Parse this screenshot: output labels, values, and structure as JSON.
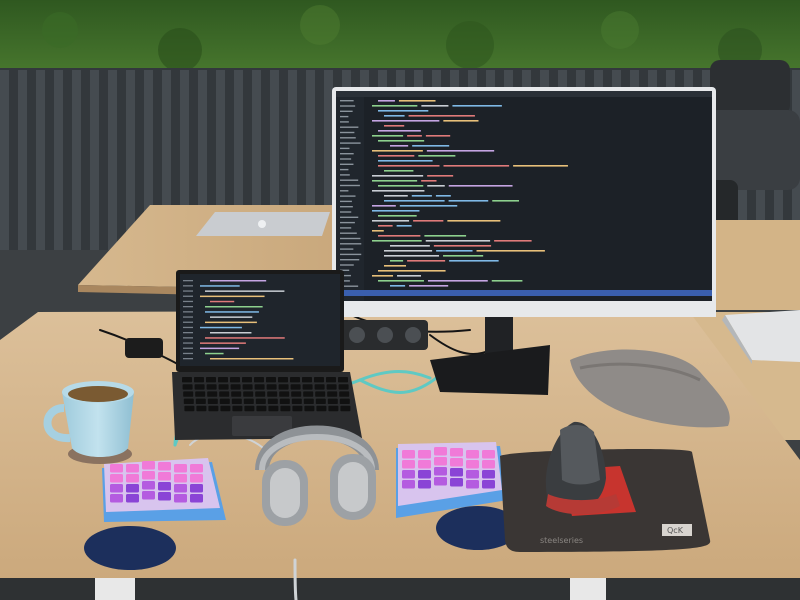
{
  "scene": {
    "kind": "photo",
    "description": "",
    "objects": {
      "moss_wall": "moss-wall",
      "fence": "slatted-fence",
      "monitor": "external-monitor",
      "laptop_open": "open-laptop",
      "laptop_closed_back": "closed-laptop",
      "laptop_closed_right": "closed-laptop",
      "keyboard_left": "split-keyboard-left-half",
      "keyboard_right": "split-keyboard-right-half",
      "headphones": "headphones",
      "mug": "tea-mug",
      "mouse": "vertical-mouse",
      "mousepad": "mousepad",
      "wrist_rest_left": "wrist-rest",
      "wrist_rest_right": "wrist-rest",
      "pouch": "grey-pouch",
      "cables": "usb-cables",
      "desk": "wooden-desk"
    },
    "colors": {
      "moss": "#3f6b2a",
      "fence": "#3a3f43",
      "desk": "#d9b98c",
      "screen": "#1c2127",
      "keycaps_pink": "#e86ad0",
      "keycaps_purple": "#8a44d6",
      "case_blue": "#5aa0e6",
      "mug": "#a9d3e3",
      "cable": "#5fc9c3"
    }
  },
  "labels": {
    "mousepad_brand": "steelseries",
    "mousepad_tag": "QcK"
  }
}
